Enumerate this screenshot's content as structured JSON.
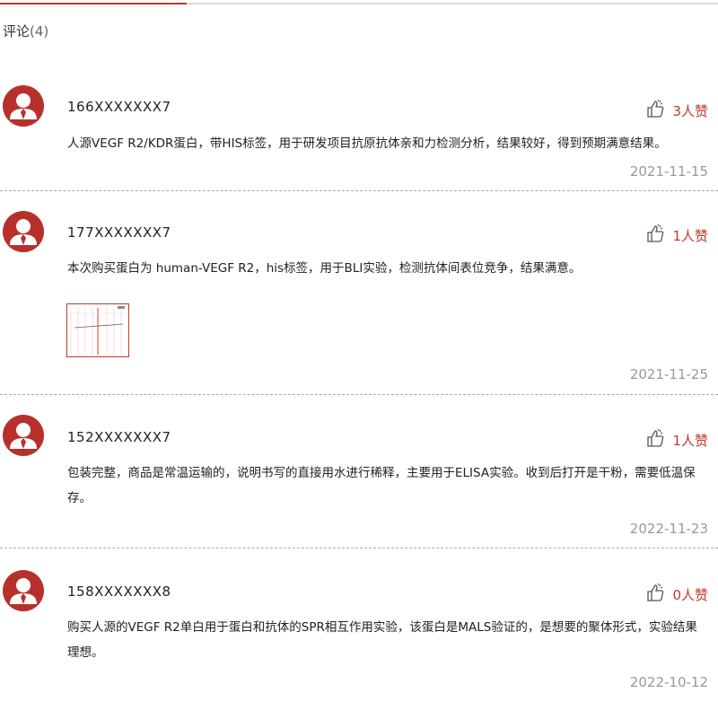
{
  "comments_header": {
    "label": "评论",
    "count": "(4)"
  },
  "reviews": [
    {
      "user": "166XXXXXXX7",
      "likes": "3人赞",
      "text": "人源VEGF R2/KDR蛋白，带HIS标签，用于研发项目抗原抗体亲和力检测分析，结果较好，得到预期满意结果。",
      "date": "2021-11-15"
    },
    {
      "user": "177XXXXXXX7",
      "likes": "1人赞",
      "text": "本次购买蛋白为 human-VEGF R2，his标签，用于BLI实验，检测抗体间表位竞争，结果满意。",
      "date": "2021-11-25",
      "has_image": true
    },
    {
      "user": "152XXXXXXX7",
      "likes": "1人赞",
      "text": "包装完整，商品是常温运输的，说明书写的直接用水进行稀释，主要用于ELISA实验。收到后打开是干粉，需要低温保存。",
      "date": "2022-11-23"
    },
    {
      "user": "158XXXXXXX8",
      "likes": "0人赞",
      "text": "购买人源的VEGF R2单白用于蛋白和抗体的SPR相互作用实验，该蛋白是MALS验证的，是想要的聚体形式，实验结果理想。",
      "date": "2022-10-12"
    }
  ],
  "icons": {
    "avatar": "user-avatar-icon",
    "like": "thumbs-up-icon"
  },
  "colors": {
    "accent": "#c0392b",
    "avatar_bg": "#b8302c",
    "muted": "#999999"
  }
}
